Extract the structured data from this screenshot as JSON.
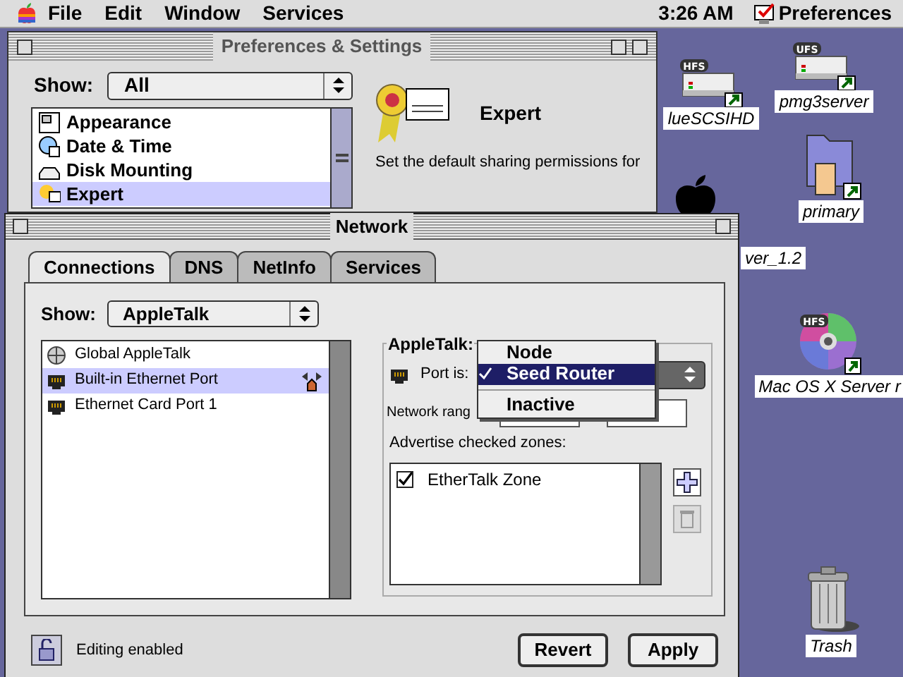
{
  "menu_bar": {
    "menus": [
      "File",
      "Edit",
      "Window",
      "Services"
    ],
    "clock": "3:26 AM",
    "app": "Preferences"
  },
  "desktop_icons": [
    {
      "kind": "drive",
      "badge": "HFS",
      "label": "lueSCSIHD"
    },
    {
      "kind": "drive",
      "badge": "UFS",
      "label": "pmg3server"
    },
    {
      "kind": "folder",
      "label": "primary"
    },
    {
      "kind": "apple",
      "label": "ver_1.2"
    },
    {
      "kind": "disc",
      "badge": "HFS",
      "label": "Mac OS X Server r"
    },
    {
      "kind": "trash",
      "label": "Trash"
    }
  ],
  "preferences_window": {
    "title": "Preferences & Settings",
    "show_label": "Show:",
    "show_value": "All",
    "items": [
      {
        "label": "Appearance",
        "selected": false
      },
      {
        "label": "Date & Time",
        "selected": false
      },
      {
        "label": "Disk Mounting",
        "selected": false
      },
      {
        "label": "Expert",
        "selected": true
      }
    ],
    "detail_title": "Expert",
    "detail_text": "Set the default sharing permissions for"
  },
  "network_window": {
    "title": "Network",
    "tabs": [
      {
        "label": "Connections",
        "selected": true
      },
      {
        "label": "DNS",
        "selected": false
      },
      {
        "label": "NetInfo",
        "selected": false
      },
      {
        "label": "Services",
        "selected": false
      }
    ],
    "show_label": "Show:",
    "show_value": "AppleTalk",
    "ports": [
      {
        "label": "Global AppleTalk",
        "kind": "global",
        "selected": false,
        "router": false
      },
      {
        "label": "Built-in Ethernet Port",
        "kind": "ethernet",
        "selected": true,
        "router": true
      },
      {
        "label": "Ethernet Card Port 1",
        "kind": "ethernet",
        "selected": false,
        "router": false
      }
    ],
    "group_title": "AppleTalk:",
    "port_label": "Port is:",
    "port_menu": [
      {
        "label": "Node",
        "selected": false
      },
      {
        "label": "Seed Router",
        "selected": true
      },
      {
        "label": "Inactive",
        "selected": false
      }
    ],
    "network_range_label": "Network rang",
    "advertise_label": "Advertise checked zones:",
    "zones": [
      {
        "label": "EtherTalk Zone",
        "checked": true
      }
    ],
    "lock_status": "Editing enabled",
    "buttons": [
      "Revert",
      "Apply"
    ]
  }
}
